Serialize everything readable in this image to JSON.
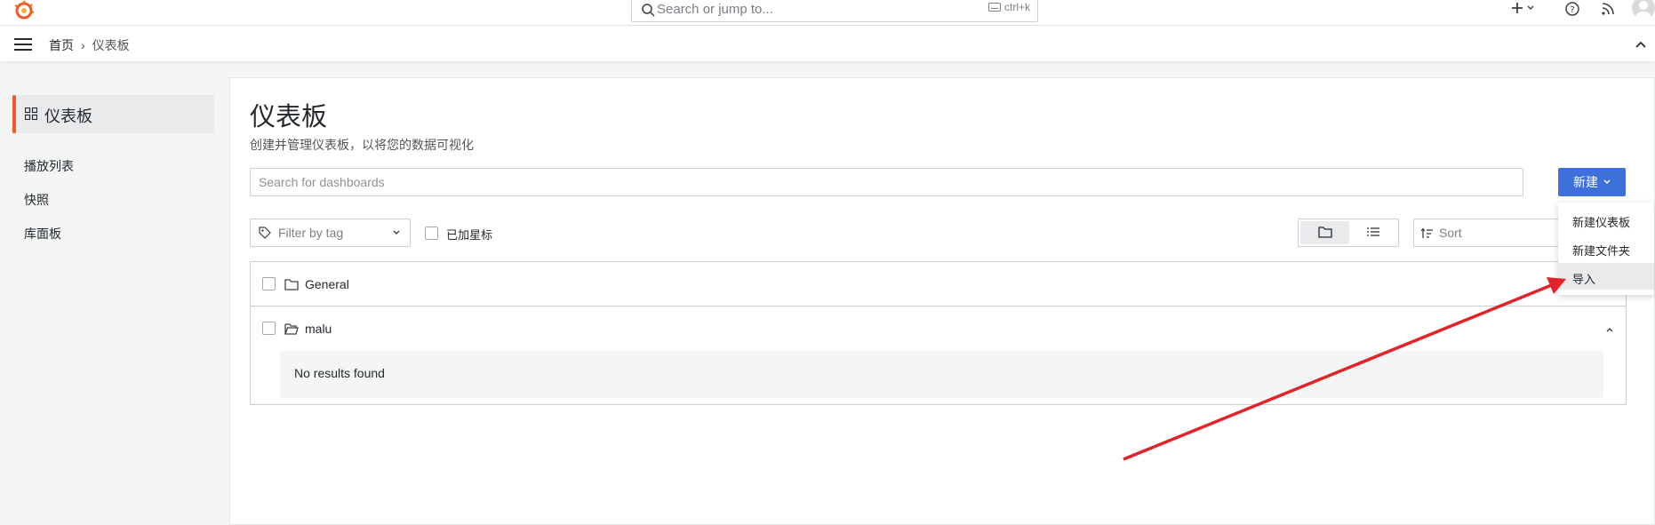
{
  "topbar": {
    "search_placeholder": "Search or jump to...",
    "shortcut": "ctrl+k"
  },
  "breadcrumb": {
    "home": "首页",
    "separator": "›",
    "current": "仪表板"
  },
  "sidebar": {
    "active_label": "仪表板",
    "items": [
      {
        "label": "播放列表"
      },
      {
        "label": "快照"
      },
      {
        "label": "库面板"
      }
    ]
  },
  "page": {
    "title": "仪表板",
    "subtitle": "创建并管理仪表板，以将您的数据可视化",
    "search_placeholder": "Search for dashboards",
    "new_button": "新建",
    "tag_filter_placeholder": "Filter by tag",
    "starred_label": "已加星标",
    "sort_placeholder": "Sort"
  },
  "folders": [
    {
      "name": "General"
    },
    {
      "name": "malu",
      "empty_text": "No results found"
    }
  ],
  "new_menu": {
    "items": [
      {
        "label": "新建仪表板"
      },
      {
        "label": "新建文件夹"
      },
      {
        "label": "导入"
      }
    ]
  },
  "colors": {
    "accent": "#f05a28",
    "primary_button": "#3d71d9",
    "annotation_arrow": "#e0242a"
  }
}
